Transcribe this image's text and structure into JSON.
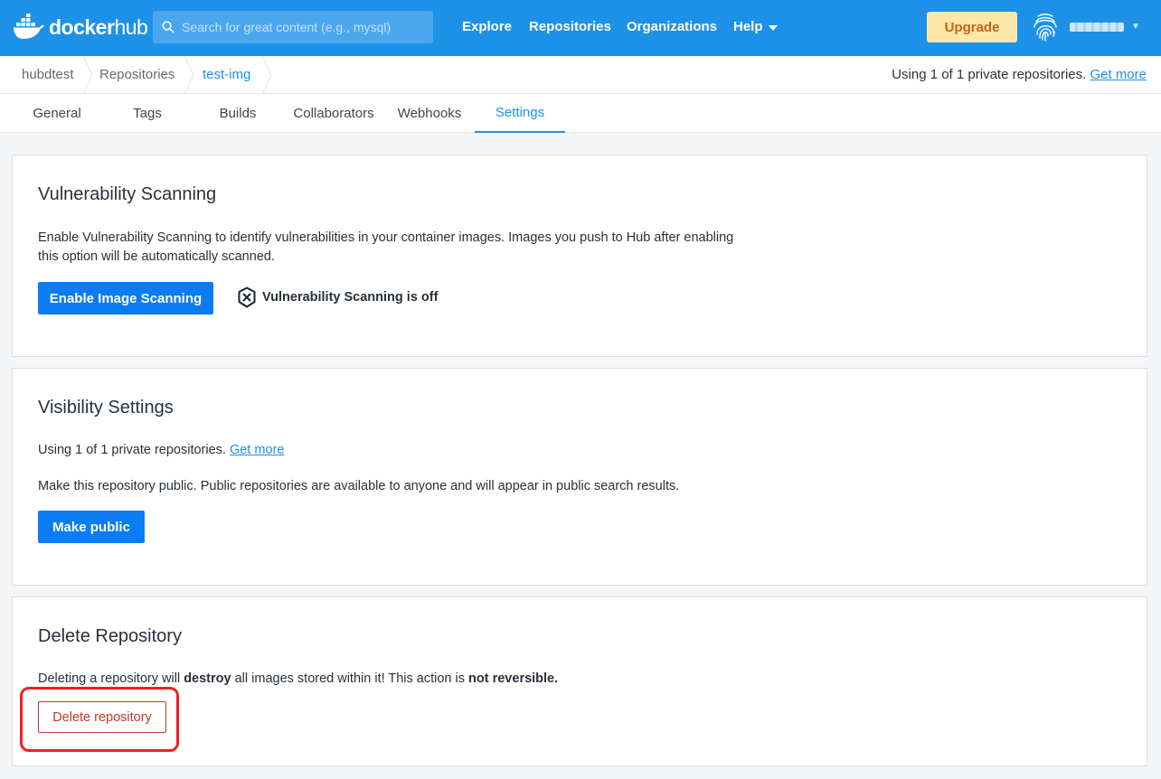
{
  "topnav": {
    "logo_text_bold": "docker",
    "logo_text_light": "hub",
    "search_placeholder": "Search for great content (e.g., mysql)",
    "links": [
      "Explore",
      "Repositories",
      "Organizations",
      "Help"
    ],
    "upgrade_label": "Upgrade",
    "brand_color": "#1d91e8"
  },
  "breadcrumb": {
    "items": [
      "hubdtest",
      "Repositories",
      "test-img"
    ],
    "private_note": "Using 1 of 1 private repositories.",
    "get_more": "Get more"
  },
  "tabs": [
    "General",
    "Tags",
    "Builds",
    "Collaborators",
    "Webhooks",
    "Settings"
  ],
  "active_tab": "Settings",
  "vulnerability": {
    "title": "Vulnerability Scanning",
    "description_line1": "Enable Vulnerability Scanning to identify vulnerabilities in your container images. Images you push to Hub after enabling",
    "description_line2": "this option will be automatically scanned.",
    "button_label": "Enable Image Scanning",
    "status_text": "Vulnerability Scanning is off"
  },
  "visibility": {
    "title": "Visibility Settings",
    "usage_text": "Using 1 of 1 private repositories.",
    "get_more": "Get more",
    "description": "Make this repository public. Public repositories are available to anyone and will appear in public search results.",
    "button_label": "Make public"
  },
  "delete": {
    "title": "Delete Repository",
    "text_part1": "Deleting a repository will ",
    "text_bold1": "destroy",
    "text_part2": " all images stored within it! This action is ",
    "text_bold2": "not reversible.",
    "button_label": "Delete repository",
    "danger_color": "#c0392b"
  }
}
